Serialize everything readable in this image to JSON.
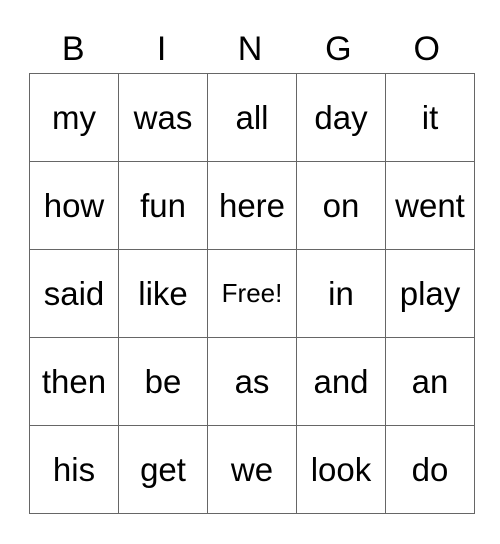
{
  "card": {
    "header": [
      "B",
      "I",
      "N",
      "G",
      "O"
    ],
    "rows": [
      [
        "my",
        "was",
        "all",
        "day",
        "it"
      ],
      [
        "how",
        "fun",
        "here",
        "on",
        "went"
      ],
      [
        "said",
        "like",
        "Free!",
        "in",
        "play"
      ],
      [
        "then",
        "be",
        "as",
        "and",
        "an"
      ],
      [
        "his",
        "get",
        "we",
        "look",
        "do"
      ]
    ],
    "free_space": "Free!"
  }
}
